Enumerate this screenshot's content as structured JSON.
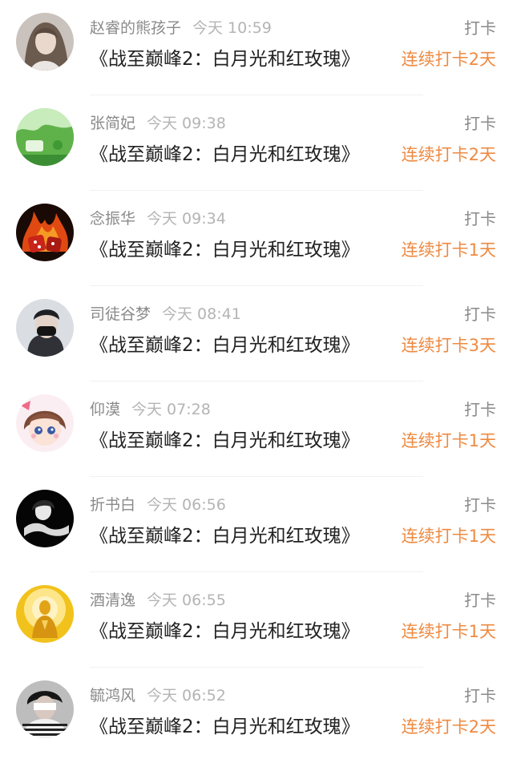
{
  "checkins": [
    {
      "name": "赵睿的熊孩子",
      "time": "今天 10:59",
      "title": "《战至巅峰2：白月光和红玫瑰》",
      "action": "打卡",
      "streak": "连续打卡2天"
    },
    {
      "name": "张简妃",
      "time": "今天 09:38",
      "title": "《战至巅峰2：白月光和红玫瑰》",
      "action": "打卡",
      "streak": "连续打卡2天"
    },
    {
      "name": "念振华",
      "time": "今天 09:34",
      "title": "《战至巅峰2：白月光和红玫瑰》",
      "action": "打卡",
      "streak": "连续打卡1天"
    },
    {
      "name": "司徒谷梦",
      "time": "今天 08:41",
      "title": "《战至巅峰2：白月光和红玫瑰》",
      "action": "打卡",
      "streak": "连续打卡3天"
    },
    {
      "name": "仰漠",
      "time": "今天 07:28",
      "title": "《战至巅峰2：白月光和红玫瑰》",
      "action": "打卡",
      "streak": "连续打卡1天"
    },
    {
      "name": "折书白",
      "time": "今天 06:56",
      "title": "《战至巅峰2：白月光和红玫瑰》",
      "action": "打卡",
      "streak": "连续打卡1天"
    },
    {
      "name": "酒清逸",
      "time": "今天 06:55",
      "title": "《战至巅峰2：白月光和红玫瑰》",
      "action": "打卡",
      "streak": "连续打卡1天"
    },
    {
      "name": "毓鸿风",
      "time": "今天 06:52",
      "title": "《战至巅峰2：白月光和红玫瑰》",
      "action": "打卡",
      "streak": "连续打卡2天"
    }
  ],
  "colors": {
    "streak": "#ee8a42",
    "name": "#8a8a8a",
    "time": "#b4b4b4",
    "title": "#222222"
  }
}
